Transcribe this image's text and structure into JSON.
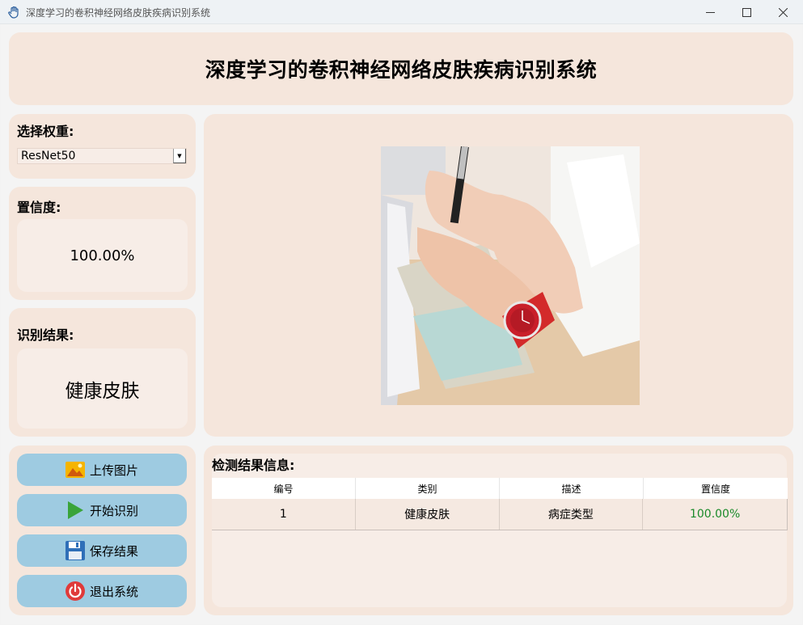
{
  "window": {
    "title": "深度学习的卷积神经网络皮肤疾病识别系统",
    "min_glyph": "—",
    "max_glyph": "☐",
    "close_glyph": "✕"
  },
  "header": {
    "title": "深度学习的卷积神经网络皮肤疾病识别系统"
  },
  "weight": {
    "label": "选择权重:",
    "selected": "ResNet50",
    "arrow": "▼"
  },
  "confidence": {
    "label": "置信度:",
    "value": "100.00%"
  },
  "result": {
    "label": "识别结果:",
    "value": "健康皮肤"
  },
  "image_panel": {
    "icon": "photo-hand-writing-with-red-watch"
  },
  "buttons": {
    "upload": {
      "label": "上传图片",
      "icon": "image-icon"
    },
    "start": {
      "label": "开始识别",
      "icon": "play-icon"
    },
    "save": {
      "label": "保存结果",
      "icon": "floppy-disk-icon"
    },
    "exit": {
      "label": "退出系统",
      "icon": "power-icon"
    }
  },
  "results_table": {
    "label": "检测结果信息:",
    "columns": [
      "编号",
      "类别",
      "描述",
      "置信度"
    ],
    "rows": [
      {
        "id": "1",
        "category": "健康皮肤",
        "description": "病症类型",
        "confidence": "100.00%"
      }
    ]
  },
  "colors": {
    "panel": "#f5e6dc",
    "inner": "#f7ede7",
    "button": "#9ecbe1",
    "confidence_green": "#1a8a2a"
  }
}
